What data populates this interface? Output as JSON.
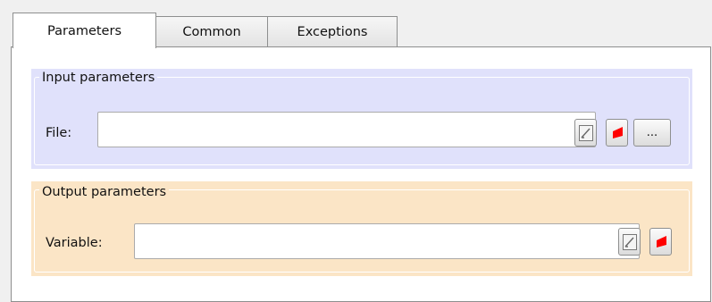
{
  "tabs": [
    {
      "label": "Parameters",
      "active": true
    },
    {
      "label": "Common",
      "active": false
    },
    {
      "label": "Exceptions",
      "active": false
    }
  ],
  "input_group": {
    "title": "Input parameters",
    "file_label": "File:",
    "file_value": "",
    "browse_label": "...",
    "background": "#e0e1fb"
  },
  "output_group": {
    "title": "Output parameters",
    "variable_label": "Variable:",
    "variable_value": "",
    "background": "#fbe5c6"
  },
  "icons": {
    "expression": "expression-edit-icon",
    "marker": "red-corner-flag-icon"
  }
}
